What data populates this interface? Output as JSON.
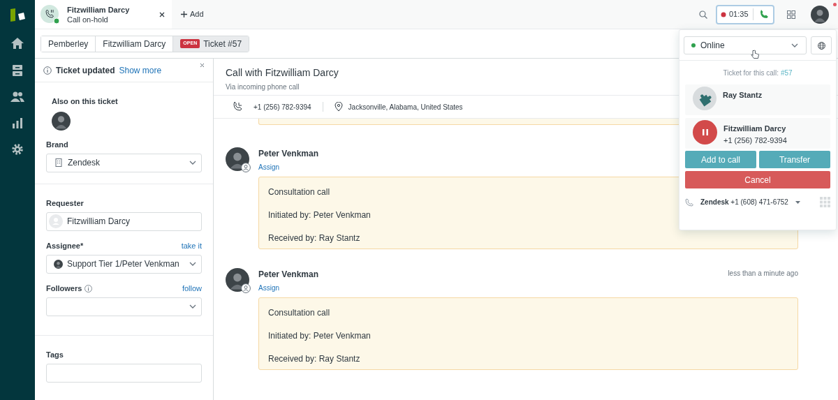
{
  "call_tab": {
    "name": "Fitzwilliam Darcy",
    "status": "Call on-hold"
  },
  "add_label": "Add",
  "timer": "01:35",
  "breadcrumbs": [
    {
      "label": "Pemberley",
      "selected": false
    },
    {
      "label": "Fitzwilliam Darcy",
      "selected": false
    },
    {
      "label": "Ticket #57",
      "badge": "OPEN",
      "selected": true
    }
  ],
  "notice": {
    "title": "Ticket updated",
    "link": "Show more"
  },
  "sidebar": {
    "also_on_ticket": "Also on this ticket",
    "sections": [
      [
        {
          "kind": "brand",
          "label": "Brand",
          "value": "Zendesk"
        }
      ],
      [
        {
          "kind": "requester",
          "label": "Requester",
          "value": "Fitzwilliam Darcy"
        },
        {
          "kind": "assignee",
          "label": "Assignee*",
          "value": "Support Tier 1/Peter Venkman",
          "action": "take it"
        },
        {
          "kind": "followers",
          "label": "Followers",
          "action": "follow"
        }
      ],
      [
        {
          "kind": "tags",
          "label": "Tags"
        }
      ]
    ]
  },
  "conversation": {
    "title": "Call with Fitzwilliam Darcy",
    "subtitle": "Via incoming phone call",
    "phone": "+1 (256) 782-9394",
    "location": "Jacksonville, Alabama, United States",
    "messages": [
      {
        "author": "Peter Venkman",
        "action": "Assign",
        "lines": [
          "Consultation call",
          "Initiated by: Peter Venkman",
          "Received by: Ray Stantz"
        ]
      },
      {
        "author": "Peter Venkman",
        "action": "Assign",
        "timestamp": "less than a minute ago",
        "lines": [
          "Consultation call",
          "Initiated by: Peter Venkman",
          "Received by: Ray Stantz"
        ]
      }
    ]
  },
  "call_panel": {
    "status": "Online",
    "ticket_label": "Ticket for this call:",
    "ticket_link": "#57",
    "participants": [
      {
        "kind": "agent",
        "name": "Ray Stantz"
      },
      {
        "kind": "on_hold",
        "name": "Fitzwilliam Darcy",
        "phone": "+1 (256) 782-9394"
      }
    ],
    "buttons": [
      {
        "kind": "primary",
        "label": "Add to call"
      },
      {
        "kind": "primary",
        "label": "Transfer"
      },
      {
        "kind": "danger",
        "label": "Cancel"
      }
    ],
    "line": {
      "name": "Zendesk",
      "number": "+1 (608) 471-6752"
    }
  }
}
